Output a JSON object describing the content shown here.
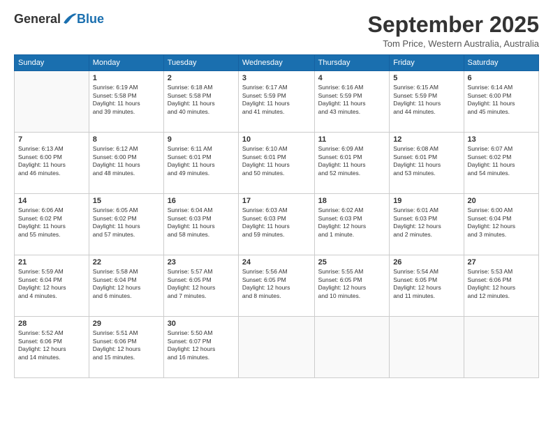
{
  "header": {
    "logo_general": "General",
    "logo_blue": "Blue",
    "month": "September 2025",
    "location": "Tom Price, Western Australia, Australia"
  },
  "days_of_week": [
    "Sunday",
    "Monday",
    "Tuesday",
    "Wednesday",
    "Thursday",
    "Friday",
    "Saturday"
  ],
  "weeks": [
    [
      {
        "day": "",
        "info": ""
      },
      {
        "day": "1",
        "info": "Sunrise: 6:19 AM\nSunset: 5:58 PM\nDaylight: 11 hours\nand 39 minutes."
      },
      {
        "day": "2",
        "info": "Sunrise: 6:18 AM\nSunset: 5:58 PM\nDaylight: 11 hours\nand 40 minutes."
      },
      {
        "day": "3",
        "info": "Sunrise: 6:17 AM\nSunset: 5:59 PM\nDaylight: 11 hours\nand 41 minutes."
      },
      {
        "day": "4",
        "info": "Sunrise: 6:16 AM\nSunset: 5:59 PM\nDaylight: 11 hours\nand 43 minutes."
      },
      {
        "day": "5",
        "info": "Sunrise: 6:15 AM\nSunset: 5:59 PM\nDaylight: 11 hours\nand 44 minutes."
      },
      {
        "day": "6",
        "info": "Sunrise: 6:14 AM\nSunset: 6:00 PM\nDaylight: 11 hours\nand 45 minutes."
      }
    ],
    [
      {
        "day": "7",
        "info": "Sunrise: 6:13 AM\nSunset: 6:00 PM\nDaylight: 11 hours\nand 46 minutes."
      },
      {
        "day": "8",
        "info": "Sunrise: 6:12 AM\nSunset: 6:00 PM\nDaylight: 11 hours\nand 48 minutes."
      },
      {
        "day": "9",
        "info": "Sunrise: 6:11 AM\nSunset: 6:01 PM\nDaylight: 11 hours\nand 49 minutes."
      },
      {
        "day": "10",
        "info": "Sunrise: 6:10 AM\nSunset: 6:01 PM\nDaylight: 11 hours\nand 50 minutes."
      },
      {
        "day": "11",
        "info": "Sunrise: 6:09 AM\nSunset: 6:01 PM\nDaylight: 11 hours\nand 52 minutes."
      },
      {
        "day": "12",
        "info": "Sunrise: 6:08 AM\nSunset: 6:01 PM\nDaylight: 11 hours\nand 53 minutes."
      },
      {
        "day": "13",
        "info": "Sunrise: 6:07 AM\nSunset: 6:02 PM\nDaylight: 11 hours\nand 54 minutes."
      }
    ],
    [
      {
        "day": "14",
        "info": "Sunrise: 6:06 AM\nSunset: 6:02 PM\nDaylight: 11 hours\nand 55 minutes."
      },
      {
        "day": "15",
        "info": "Sunrise: 6:05 AM\nSunset: 6:02 PM\nDaylight: 11 hours\nand 57 minutes."
      },
      {
        "day": "16",
        "info": "Sunrise: 6:04 AM\nSunset: 6:03 PM\nDaylight: 11 hours\nand 58 minutes."
      },
      {
        "day": "17",
        "info": "Sunrise: 6:03 AM\nSunset: 6:03 PM\nDaylight: 11 hours\nand 59 minutes."
      },
      {
        "day": "18",
        "info": "Sunrise: 6:02 AM\nSunset: 6:03 PM\nDaylight: 12 hours\nand 1 minute."
      },
      {
        "day": "19",
        "info": "Sunrise: 6:01 AM\nSunset: 6:03 PM\nDaylight: 12 hours\nand 2 minutes."
      },
      {
        "day": "20",
        "info": "Sunrise: 6:00 AM\nSunset: 6:04 PM\nDaylight: 12 hours\nand 3 minutes."
      }
    ],
    [
      {
        "day": "21",
        "info": "Sunrise: 5:59 AM\nSunset: 6:04 PM\nDaylight: 12 hours\nand 4 minutes."
      },
      {
        "day": "22",
        "info": "Sunrise: 5:58 AM\nSunset: 6:04 PM\nDaylight: 12 hours\nand 6 minutes."
      },
      {
        "day": "23",
        "info": "Sunrise: 5:57 AM\nSunset: 6:05 PM\nDaylight: 12 hours\nand 7 minutes."
      },
      {
        "day": "24",
        "info": "Sunrise: 5:56 AM\nSunset: 6:05 PM\nDaylight: 12 hours\nand 8 minutes."
      },
      {
        "day": "25",
        "info": "Sunrise: 5:55 AM\nSunset: 6:05 PM\nDaylight: 12 hours\nand 10 minutes."
      },
      {
        "day": "26",
        "info": "Sunrise: 5:54 AM\nSunset: 6:05 PM\nDaylight: 12 hours\nand 11 minutes."
      },
      {
        "day": "27",
        "info": "Sunrise: 5:53 AM\nSunset: 6:06 PM\nDaylight: 12 hours\nand 12 minutes."
      }
    ],
    [
      {
        "day": "28",
        "info": "Sunrise: 5:52 AM\nSunset: 6:06 PM\nDaylight: 12 hours\nand 14 minutes."
      },
      {
        "day": "29",
        "info": "Sunrise: 5:51 AM\nSunset: 6:06 PM\nDaylight: 12 hours\nand 15 minutes."
      },
      {
        "day": "30",
        "info": "Sunrise: 5:50 AM\nSunset: 6:07 PM\nDaylight: 12 hours\nand 16 minutes."
      },
      {
        "day": "",
        "info": ""
      },
      {
        "day": "",
        "info": ""
      },
      {
        "day": "",
        "info": ""
      },
      {
        "day": "",
        "info": ""
      }
    ]
  ]
}
